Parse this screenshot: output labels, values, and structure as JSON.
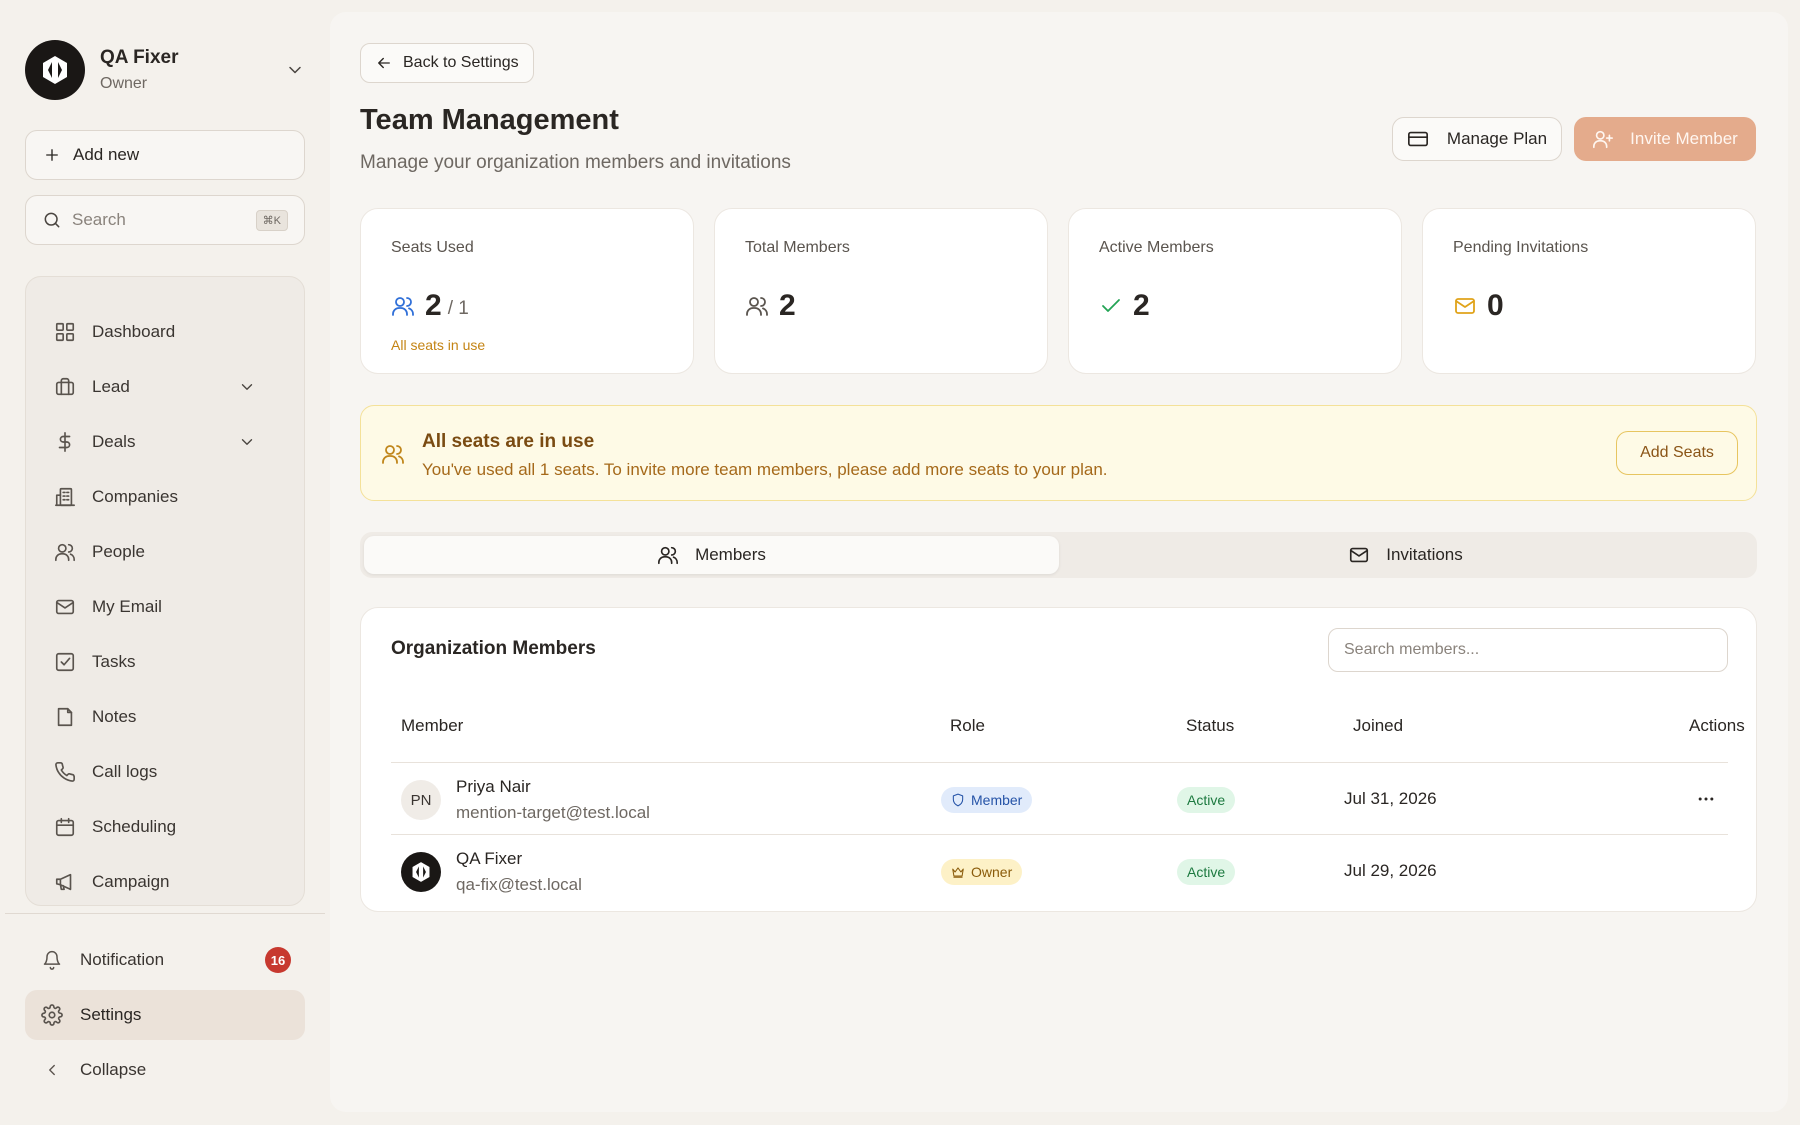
{
  "sidebar": {
    "org": {
      "name": "QA Fixer",
      "role": "Owner"
    },
    "add_new": "Add new",
    "search": {
      "placeholder": "Search",
      "shortcut": "⌘K"
    },
    "items": [
      {
        "label": "Dashboard",
        "icon": "dashboard-icon"
      },
      {
        "label": "Lead",
        "icon": "briefcase-icon",
        "expandable": true
      },
      {
        "label": "Deals",
        "icon": "dollar-icon",
        "expandable": true
      },
      {
        "label": "Companies",
        "icon": "building-icon"
      },
      {
        "label": "People",
        "icon": "users-icon"
      },
      {
        "label": "My Email",
        "icon": "mail-icon"
      },
      {
        "label": "Tasks",
        "icon": "checkbox-icon"
      },
      {
        "label": "Notes",
        "icon": "note-icon"
      },
      {
        "label": "Call logs",
        "icon": "phone-icon"
      },
      {
        "label": "Scheduling",
        "icon": "calendar-icon"
      },
      {
        "label": "Campaign",
        "icon": "megaphone-icon"
      }
    ],
    "notification": {
      "label": "Notification",
      "count": "16"
    },
    "settings": "Settings",
    "collapse": "Collapse"
  },
  "header": {
    "back": "Back to Settings",
    "title": "Team Management",
    "subtitle": "Manage your organization members and invitations",
    "manage_plan": "Manage Plan",
    "invite": "Invite Member"
  },
  "stats": [
    {
      "label": "Seats Used",
      "value": "2",
      "of": "/ 1",
      "note": "All seats in use"
    },
    {
      "label": "Total Members",
      "value": "2"
    },
    {
      "label": "Active Members",
      "value": "2"
    },
    {
      "label": "Pending Invitations",
      "value": "0"
    }
  ],
  "alert": {
    "title": "All seats are in use",
    "text": "You've used all 1 seats. To invite more team members, please add more seats to your plan.",
    "button": "Add Seats"
  },
  "tabs": [
    {
      "label": "Members",
      "active": true
    },
    {
      "label": "Invitations",
      "active": false
    }
  ],
  "members": {
    "title": "Organization Members",
    "search_placeholder": "Search members...",
    "columns": [
      "Member",
      "Role",
      "Status",
      "Joined",
      "Actions"
    ],
    "rows": [
      {
        "initials": "PN",
        "name": "Priya Nair",
        "email": "mention-target@test.local",
        "role": "Member",
        "status": "Active",
        "joined": "Jul 31, 2026",
        "has_actions": true
      },
      {
        "initials": "",
        "name": "QA Fixer",
        "email": "qa-fix@test.local",
        "role": "Owner",
        "status": "Active",
        "joined": "Jul 29, 2026",
        "has_actions": false
      }
    ]
  },
  "colors": {
    "accent": "#e4ab8c",
    "warning_bg": "#fefae6",
    "active_status": "#1d7a40",
    "badge": "#c7392f"
  }
}
